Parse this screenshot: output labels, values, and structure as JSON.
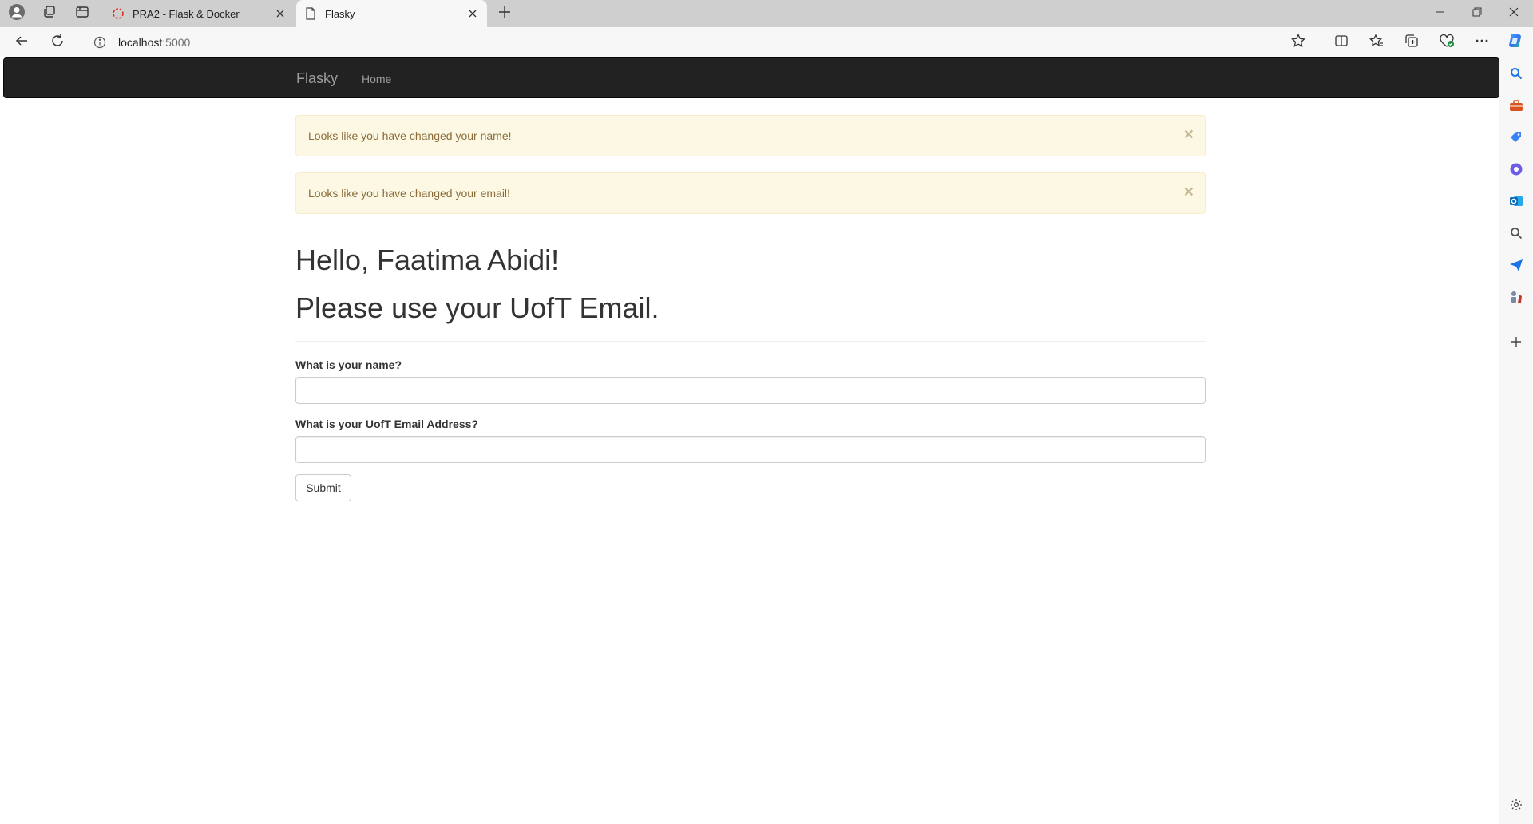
{
  "browser": {
    "tabs": [
      {
        "title": "PRA2 - Flask & Docker",
        "active": false
      },
      {
        "title": "Flasky",
        "active": true
      }
    ],
    "address": {
      "host": "localhost",
      "port": ":5000"
    }
  },
  "navbar": {
    "brand": "Flasky",
    "links": [
      "Home"
    ]
  },
  "alerts": [
    {
      "message": "Looks like you have changed your name!",
      "close": "×"
    },
    {
      "message": "Looks like you have changed your email!",
      "close": "×"
    }
  ],
  "page": {
    "greeting": "Hello, Faatima Abidi!",
    "notice": "Please use your UofT Email."
  },
  "form": {
    "name_label": "What is your name?",
    "name_value": "",
    "email_label": "What is your UofT Email Address?",
    "email_value": "",
    "submit_label": "Submit"
  },
  "colors": {
    "navbar_bg": "#222222",
    "alert_bg": "#fcf8e3",
    "alert_text": "#8a6d3b",
    "tabbar_bg": "#cfcfcf"
  }
}
